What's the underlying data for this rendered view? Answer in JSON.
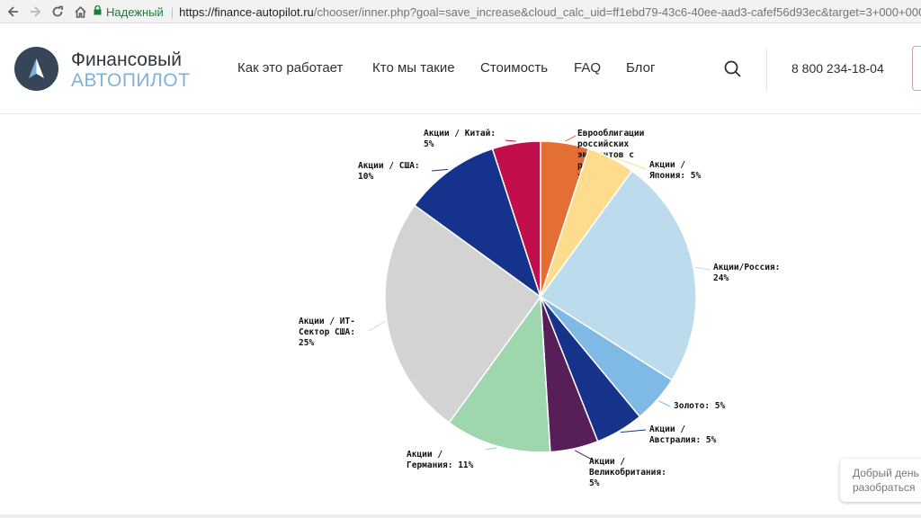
{
  "browser": {
    "secure_label": "Надежный",
    "url_host": "https://finance-autopilot.ru",
    "url_rest": "/chooser/inner.php?goal=save_increase&cloud_calc_uid=ff1ebd79-43c6-40ee-aad3-cafef56d93ec&target=3+000+000&p"
  },
  "header": {
    "logo_line1": "Финансовый",
    "logo_line2": "АВТОПИЛОТ",
    "menu": [
      "Как это работает",
      "Кто мы такие",
      "Стоимость",
      "FAQ",
      "Блог"
    ],
    "phone": "8 800 234-18-04"
  },
  "chart_data": {
    "type": "pie",
    "slices": [
      {
        "label": [
          "Еврооблигации",
          "российских",
          "эмитентов с",
          "рублевым",
          "хеджем: 5%"
        ],
        "value": 5,
        "color": "#e36f35"
      },
      {
        "label": [
          "Акции /",
          "Япония: 5%"
        ],
        "value": 5,
        "color": "#fddc8d"
      },
      {
        "label": [
          "Акции/Россия:",
          "24%"
        ],
        "value": 24,
        "color": "#bcdcee"
      },
      {
        "label": [
          "Золото: 5%"
        ],
        "value": 5,
        "color": "#7fb9e5"
      },
      {
        "label": [
          "Акции /",
          "Австралия: 5%"
        ],
        "value": 5,
        "color": "#16328a"
      },
      {
        "label": [
          "Акции /",
          "Великобритания:",
          "5%"
        ],
        "value": 5,
        "color": "#571e58"
      },
      {
        "label": [
          "Акции /",
          "Германия: 11%"
        ],
        "value": 11,
        "color": "#9ed6ae"
      },
      {
        "label": [
          "Акции / ИТ-",
          "Сектор США:",
          "25%"
        ],
        "value": 25,
        "color": "#d3d3d3"
      },
      {
        "label": [
          "Акции / США:",
          "10%"
        ],
        "value": 10,
        "color": "#15338c"
      },
      {
        "label": [
          "Акции / Китай:",
          "5%"
        ],
        "value": 5,
        "color": "#c20e4a"
      }
    ]
  },
  "chat_widget": {
    "line1": "Добрый день",
    "line2": "разобраться"
  },
  "icons": {
    "back": "arrow-left-icon",
    "forward": "arrow-right-icon",
    "reload": "reload-icon",
    "home": "home-icon",
    "lock": "lock-icon",
    "search": "search-icon",
    "logo": "paper-plane-logo-icon"
  }
}
